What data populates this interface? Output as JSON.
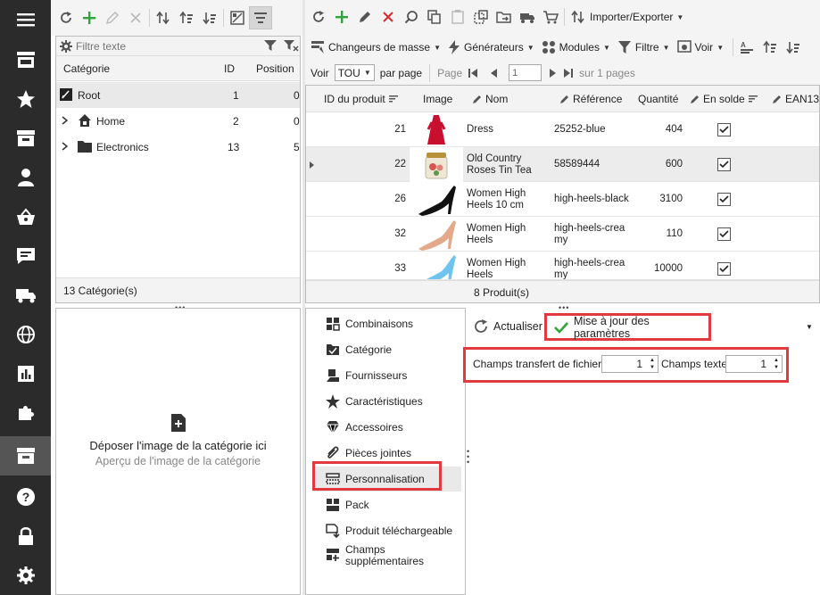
{
  "sidebar": {
    "icons": [
      "menu-icon",
      "store-icon",
      "star-icon",
      "inbox-icon",
      "user-icon",
      "basket-icon",
      "chat-icon",
      "truck-icon",
      "globe-icon",
      "chart-icon",
      "puzzle-icon",
      "catalog-icon",
      "help-icon",
      "lock-icon",
      "gear-icon"
    ]
  },
  "category_panel": {
    "filter_placeholder": "Filtre texte",
    "columns": [
      "Catégorie",
      "ID",
      "Position"
    ],
    "rows": [
      {
        "name": "Root",
        "id": "1",
        "position": "0"
      },
      {
        "name": "Home",
        "id": "2",
        "position": "0"
      },
      {
        "name": "Electronics",
        "id": "13",
        "position": "5"
      }
    ],
    "footer": "13 Catégorie(s)"
  },
  "product_toolbar": {
    "import_export": "Importer/Exporter",
    "mass_changers": "Changeurs de masse",
    "generators": "Générateurs",
    "modules": "Modules",
    "filter": "Filtre",
    "view": "Voir"
  },
  "paging": {
    "show_label": "Voir",
    "per_page_value": "TOU",
    "per_page_label": "par page",
    "page_label": "Page",
    "page_value": "1",
    "of_pages": "sur 1 pages"
  },
  "products": {
    "columns": {
      "id": "ID du produit",
      "image": "Image",
      "name": "Nom",
      "reference": "Référence",
      "quantity": "Quantité",
      "on_sale": "En solde",
      "ean": "EAN13"
    },
    "rows": [
      {
        "id": "21",
        "name": "Dress",
        "reference": "25252-blue",
        "quantity": "404",
        "on_sale": true,
        "image": "red-dress"
      },
      {
        "id": "22",
        "name": "Old Country Roses Tin Tea",
        "reference": "58589444",
        "quantity": "600",
        "on_sale": true,
        "image": "tea-tin"
      },
      {
        "id": "26",
        "name": "Women High Heels 10 cm",
        "reference": "high-heels-black",
        "quantity": "3100",
        "on_sale": true,
        "image": "black-heel"
      },
      {
        "id": "32",
        "name": "Women High Heels",
        "reference": "high-heels-creamy",
        "quantity": "110",
        "on_sale": true,
        "image": "creamy-heel"
      },
      {
        "id": "33",
        "name": "Women High Heels",
        "reference": "high-heels-creamy",
        "quantity": "10000",
        "on_sale": true,
        "image": "blue-heel"
      }
    ],
    "footer": "8 Produit(s)"
  },
  "image_panel": {
    "drop_text": "Déposer l'image de la catégorie ici",
    "preview_text": "Aperçu de l'image de la catégorie"
  },
  "detail_tabs": [
    {
      "label": "Combinaisons",
      "icon": "combinations-icon"
    },
    {
      "label": "Catégorie",
      "icon": "category-folder-icon"
    },
    {
      "label": "Fournisseurs",
      "icon": "suppliers-icon"
    },
    {
      "label": "Caractéristiques",
      "icon": "features-star-icon"
    },
    {
      "label": "Accessoires",
      "icon": "accessories-diamond-icon"
    },
    {
      "label": "Pièces jointes",
      "icon": "attachment-icon"
    },
    {
      "label": "Personnalisation",
      "icon": "customization-icon"
    },
    {
      "label": "Pack",
      "icon": "pack-icon"
    },
    {
      "label": "Produit téléchargeable",
      "icon": "download-icon"
    },
    {
      "label": "Champs supplémentaires",
      "icon": "extra-fields-icon"
    }
  ],
  "customization": {
    "refresh": "Actualiser",
    "update": "Mise à jour des paramètres",
    "file_fields_label": "Champs transfert de fichier",
    "file_fields_value": "1",
    "text_fields_label": "Champs texte",
    "text_fields_value": "1"
  },
  "colors": {
    "rail": "#2b2b2b",
    "highlight": "#e0393e",
    "add": "#2ea43a",
    "delete": "#d9292b"
  }
}
